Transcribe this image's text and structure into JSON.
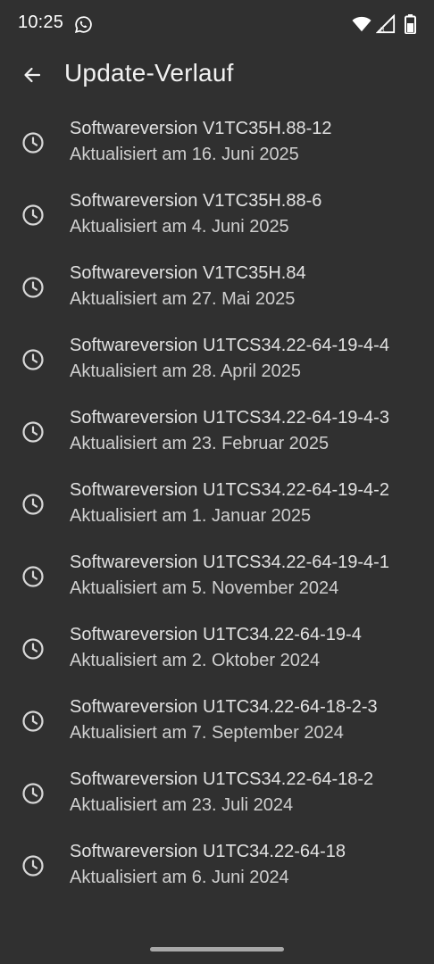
{
  "status_bar": {
    "time": "10:25",
    "notification_icon": "whatsapp-icon",
    "icons": [
      "wifi-icon",
      "signal-icon",
      "battery-icon"
    ]
  },
  "header": {
    "back_icon": "arrow-left-icon",
    "title": "Update-Verlauf"
  },
  "updates": [
    {
      "title": "Softwareversion V1TC35H.88-12",
      "date": "Aktualisiert am 16. Juni 2025"
    },
    {
      "title": "Softwareversion V1TC35H.88-6",
      "date": "Aktualisiert am 4. Juni 2025"
    },
    {
      "title": "Softwareversion V1TC35H.84",
      "date": "Aktualisiert am 27. Mai 2025"
    },
    {
      "title": "Softwareversion U1TCS34.22-64-19-4-4",
      "date": "Aktualisiert am 28. April 2025"
    },
    {
      "title": "Softwareversion U1TCS34.22-64-19-4-3",
      "date": "Aktualisiert am 23. Februar 2025"
    },
    {
      "title": "Softwareversion U1TCS34.22-64-19-4-2",
      "date": "Aktualisiert am 1. Januar 2025"
    },
    {
      "title": "Softwareversion U1TCS34.22-64-19-4-1",
      "date": "Aktualisiert am 5. November 2024"
    },
    {
      "title": "Softwareversion U1TC34.22-64-19-4",
      "date": "Aktualisiert am 2. Oktober 2024"
    },
    {
      "title": "Softwareversion U1TC34.22-64-18-2-3",
      "date": "Aktualisiert am 7. September 2024"
    },
    {
      "title": "Softwareversion U1TCS34.22-64-18-2",
      "date": "Aktualisiert am 23. Juli 2024"
    },
    {
      "title": "Softwareversion U1TC34.22-64-18",
      "date": "Aktualisiert am 6. Juni 2024"
    }
  ],
  "item_icon": "clock-icon",
  "colors": {
    "background": "#303030",
    "text_primary": "#e2e2e2",
    "text_secondary": "#cfcfcf",
    "icon": "#d8d8d8"
  }
}
